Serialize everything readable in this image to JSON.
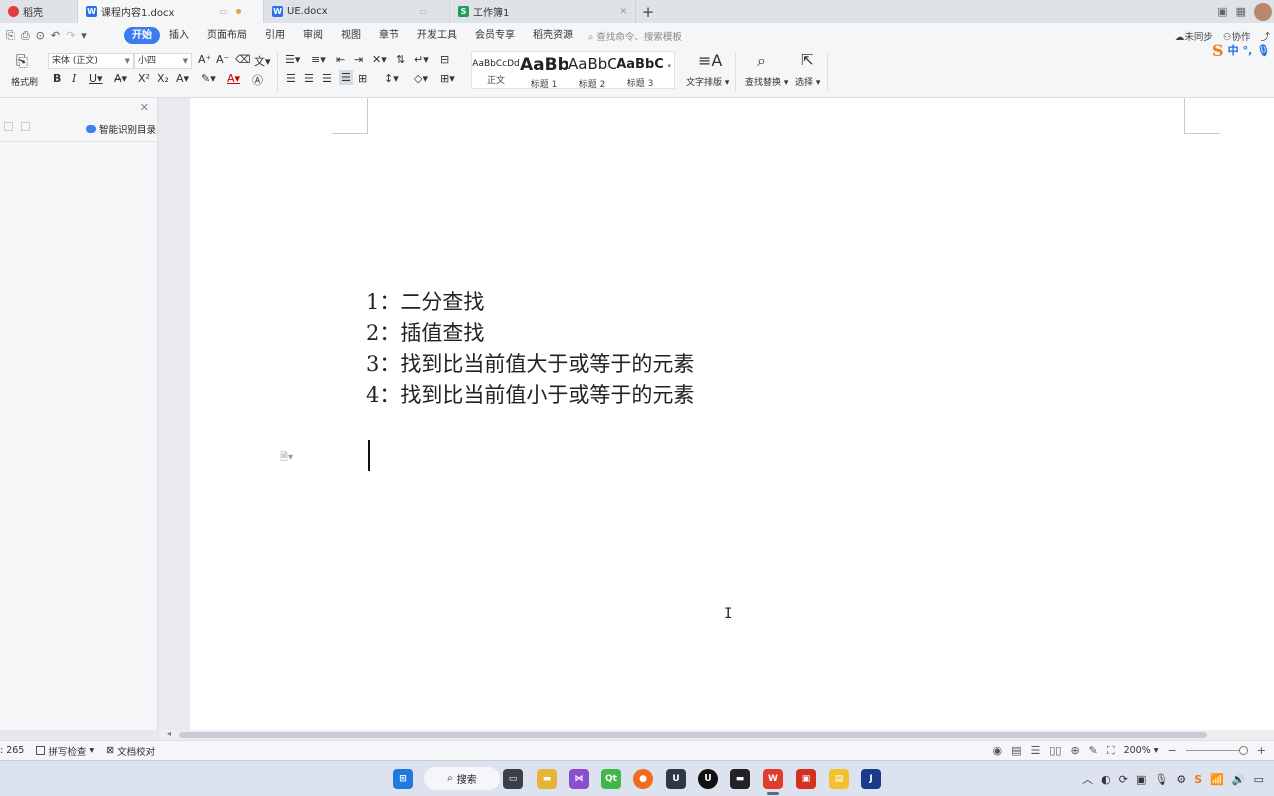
{
  "tabs": [
    {
      "label": "稻壳",
      "color": "#e33b3b",
      "icon": "docer-icon"
    },
    {
      "label": "课程内容1.docx",
      "color": "#2b6fe8",
      "icon": "wps-writer-icon",
      "active": true,
      "modified": true
    },
    {
      "label": "UE.docx",
      "color": "#2b6fe8",
      "icon": "wps-writer-icon"
    },
    {
      "label": "工作簿1",
      "color": "#1e9e58",
      "icon": "wps-sheet-icon"
    }
  ],
  "menu": {
    "items": [
      "开始",
      "插入",
      "页面布局",
      "引用",
      "审阅",
      "视图",
      "章节",
      "开发工具",
      "会员专享",
      "稻壳资源"
    ],
    "active": "开始",
    "search_placeholder": "查找命令、搜索模板",
    "sync": "未同步",
    "collab": "协作"
  },
  "ribbon": {
    "format_painter": "格式刷",
    "font_name": "宋体 (正文)",
    "font_size": "小四",
    "styles": [
      {
        "preview": "AaBbCcDd",
        "label": "正文"
      },
      {
        "preview": "AaBb",
        "label": "标题 1"
      },
      {
        "preview": "AaBbC",
        "label": "标题 2"
      },
      {
        "preview": "AaBbC",
        "label": "标题 3"
      }
    ],
    "text_layout": "文字排版",
    "find_replace": "查找替换",
    "select": "选择"
  },
  "ime": {
    "mode": "中"
  },
  "nav_pane": {
    "smart_toc": "智能识别目录"
  },
  "document": {
    "lines": [
      "1：二分查找",
      "2：插值查找",
      "3：找到比当前值大于或等于的元素",
      "4：找到比当前值小于或等于的元素"
    ]
  },
  "status": {
    "word_count": ": 265",
    "spell_check": "拼写检查",
    "proofread": "文档校对",
    "zoom": "200%"
  },
  "taskbar": {
    "search_label": "搜索"
  }
}
